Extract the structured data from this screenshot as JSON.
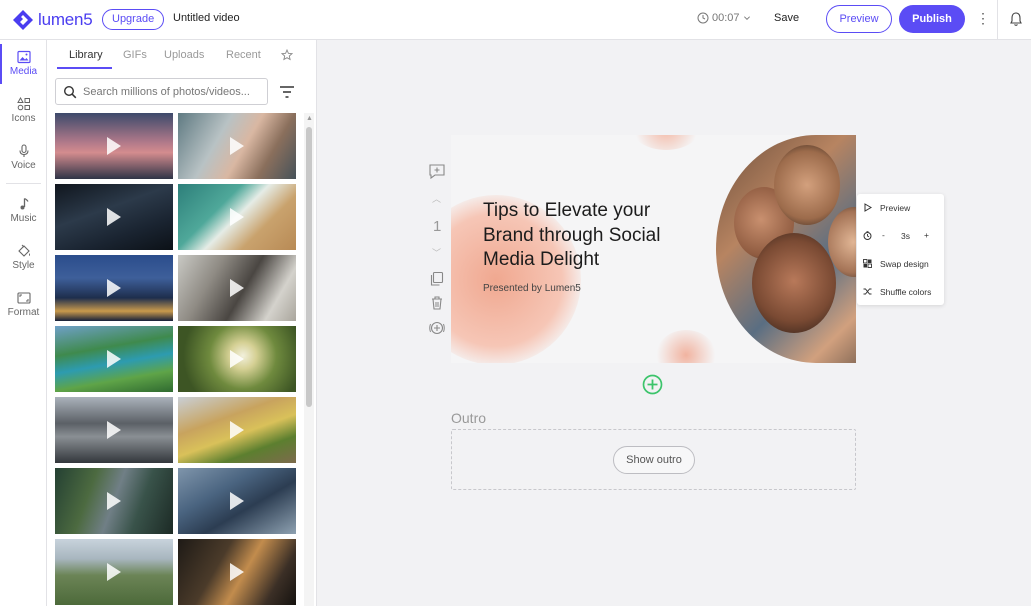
{
  "header": {
    "logo_text": "lumen5",
    "upgrade_label": "Upgrade",
    "video_title": "Untitled video",
    "duration": "00:07",
    "save_label": "Save",
    "preview_label": "Preview",
    "publish_label": "Publish",
    "accent_color": "#5b4cf5"
  },
  "rail": {
    "items": [
      {
        "label": "Media",
        "icon": "image-icon"
      },
      {
        "label": "Icons",
        "icon": "shapes-icon"
      },
      {
        "label": "Voice",
        "icon": "microphone-icon"
      },
      {
        "label": "Music",
        "icon": "music-note-icon"
      },
      {
        "label": "Style",
        "icon": "paint-bucket-icon"
      },
      {
        "label": "Format",
        "icon": "aspect-ratio-icon"
      }
    ]
  },
  "media_panel": {
    "tabs": [
      "Library",
      "GIFs",
      "Uploads",
      "Recent"
    ],
    "active_tab": "Library",
    "search_placeholder": "Search millions of photos/videos..."
  },
  "slide": {
    "number": "1",
    "title": "Tips to Elevate your Brand through Social Media Delight",
    "subtitle": "Presented by Lumen5"
  },
  "slide_menu": {
    "preview_label": "Preview",
    "duration_minus": "-",
    "duration_value": "3s",
    "duration_plus": "+",
    "swap_design_label": "Swap design",
    "shuffle_colors_label": "Shuffle colors"
  },
  "outro": {
    "label": "Outro",
    "show_outro_label": "Show outro"
  }
}
